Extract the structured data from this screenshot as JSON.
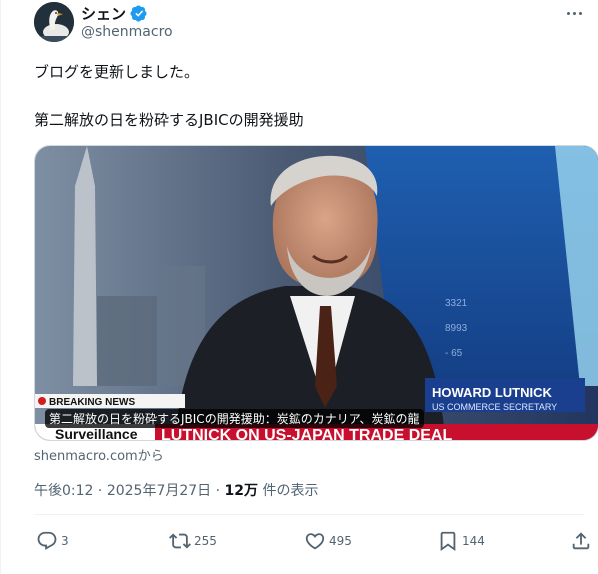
{
  "author": {
    "name": "シェン",
    "handle": "@shenmacro",
    "verified": true
  },
  "post": {
    "line1": "ブログを更新しました。",
    "line2": "第二解放の日を粉砕するJBICの開発援助"
  },
  "card": {
    "caption": "第二解放の日を粉砕するJBICの開発援助：炭鉱のカナリア、炭鉱の龍",
    "domain": "shenmacro.comから",
    "image_text": {
      "breaking": "BREAKING NEWS",
      "show": "Surveillance",
      "headline": "LUTNICK ON US-JAPAN TRADE DEAL",
      "guest_name": "HOWARD LUTNICK",
      "guest_title": "US COMMERCE SECRETARY",
      "screen_numbers": [
        "3321",
        "8993",
        "- 65"
      ]
    }
  },
  "meta": {
    "time": "午後0:12",
    "sep1": "·",
    "date": "2025年7月27日",
    "sep2": "·",
    "views_count": "12万",
    "views_label": "件の表示"
  },
  "actions": {
    "replies": "3",
    "reposts": "255",
    "likes": "495",
    "bookmarks": "144"
  },
  "colors": {
    "text": "#0f1419",
    "secondary": "#536471",
    "verified": "#1d9bf0",
    "border": "#cfd9de"
  }
}
